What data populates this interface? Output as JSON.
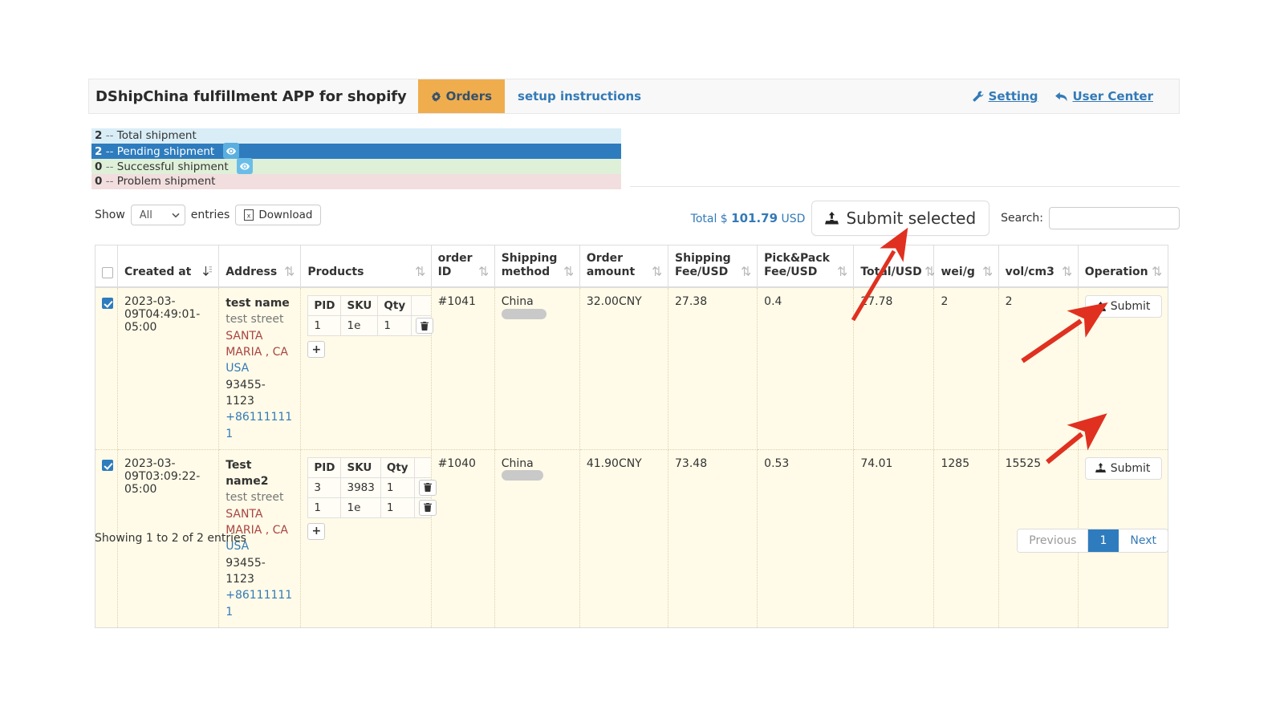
{
  "navbar": {
    "brand": "DShipChina fulfillment APP for shopify",
    "tabs": [
      {
        "label": "Orders",
        "icon": "gear-icon",
        "active": true
      },
      {
        "label": "setup instructions",
        "icon": "",
        "active": false
      }
    ],
    "right_links": [
      {
        "label": "Setting",
        "icon": "wrench-icon"
      },
      {
        "label": "User Center",
        "icon": "reply-icon"
      }
    ]
  },
  "status_bars": [
    {
      "count": "2",
      "dash": "--",
      "label": "Total shipment",
      "has_eye": false,
      "color": "#d9edf7"
    },
    {
      "count": "2",
      "dash": "--",
      "label": "Pending shipment",
      "has_eye": true,
      "color": "#2e7cbe"
    },
    {
      "count": "0",
      "dash": "--",
      "label": "Successful shipment",
      "has_eye": true,
      "color": "#dff0d8"
    },
    {
      "count": "0",
      "dash": "--",
      "label": "Problem shipment",
      "has_eye": false,
      "color": "#f2dede"
    }
  ],
  "controls": {
    "show_label": "Show",
    "entries_label": "entries",
    "length_value": "All",
    "length_options": [
      "All"
    ],
    "download_label": "Download",
    "download_icon": "excel-file-icon",
    "total_prefix": "Total $",
    "total_amount": "101.79",
    "total_suffix": "USD",
    "submit_selected_label": "Submit selected",
    "submit_selected_icon": "upload-icon",
    "search_label": "Search:",
    "search_value": "",
    "search_placeholder": ""
  },
  "table": {
    "columns": [
      {
        "key": "select",
        "label": "",
        "sortable": false,
        "sort": "none"
      },
      {
        "key": "created",
        "label": "Created at",
        "sortable": true,
        "sort": "desc"
      },
      {
        "key": "address",
        "label": "Address",
        "sortable": true,
        "sort": "none"
      },
      {
        "key": "products",
        "label": "Products",
        "sortable": true,
        "sort": "none"
      },
      {
        "key": "orderid",
        "label": "order ID",
        "sortable": true,
        "sort": "none"
      },
      {
        "key": "shipmeth",
        "label": "Shipping method",
        "sortable": true,
        "sort": "none"
      },
      {
        "key": "orderamt",
        "label": "Order amount",
        "sortable": true,
        "sort": "none"
      },
      {
        "key": "shipfee",
        "label": "Shipping Fee/USD",
        "sortable": true,
        "sort": "none"
      },
      {
        "key": "packfee",
        "label": "Pick&Pack Fee/USD",
        "sortable": true,
        "sort": "none"
      },
      {
        "key": "total",
        "label": "Total/USD",
        "sortable": true,
        "sort": "none"
      },
      {
        "key": "wei",
        "label": "wei/g",
        "sortable": true,
        "sort": "none"
      },
      {
        "key": "vol",
        "label": "vol/cm3",
        "sortable": true,
        "sort": "none"
      },
      {
        "key": "operation",
        "label": "Operation",
        "sortable": true,
        "sort": "none"
      }
    ],
    "select_all_checked": false,
    "rows": [
      {
        "checked": true,
        "created_at": "2023-03-09T04:49:01-05:00",
        "address": {
          "name": "test name",
          "street": "test street",
          "city_state": "SANTA MARIA , CA",
          "country": "USA",
          "zip": "93455-1123",
          "phone": "+861111111"
        },
        "products_headers": [
          "PID",
          "SKU",
          "Qty",
          ""
        ],
        "products": [
          {
            "pid": "1",
            "sku": "1e",
            "qty": "1",
            "delete_icon": "trash-icon"
          }
        ],
        "add_product_label": "+",
        "order_id": "#1041",
        "shipping_method": "China",
        "shipping_method_redacted": true,
        "order_amount": "32.00CNY",
        "shipping_fee": "27.38",
        "pick_pack_fee": "0.4",
        "total_usd": "27.78",
        "weight_g": "2",
        "volume_cm3": "2",
        "submit_label": "Submit",
        "submit_icon": "upload-icon"
      },
      {
        "checked": true,
        "created_at": "2023-03-09T03:09:22-05:00",
        "address": {
          "name": "Test name2",
          "street": "test street",
          "city_state": "SANTA MARIA , CA",
          "country": "USA",
          "zip": "93455-1123",
          "phone": "+861111111"
        },
        "products_headers": [
          "PID",
          "SKU",
          "Qty",
          ""
        ],
        "products": [
          {
            "pid": "3",
            "sku": "3983",
            "qty": "1",
            "delete_icon": "trash-icon"
          },
          {
            "pid": "1",
            "sku": "1e",
            "qty": "1",
            "delete_icon": "trash-icon"
          }
        ],
        "add_product_label": "+",
        "order_id": "#1040",
        "shipping_method": "China",
        "shipping_method_redacted": true,
        "order_amount": "41.90CNY",
        "shipping_fee": "73.48",
        "pick_pack_fee": "0.53",
        "total_usd": "74.01",
        "weight_g": "1285",
        "volume_cm3": "15525",
        "submit_label": "Submit",
        "submit_icon": "upload-icon"
      }
    ]
  },
  "footer": {
    "info": "Showing 1 to 2 of 2 entries",
    "pagination": [
      {
        "label": "Previous",
        "state": "disabled"
      },
      {
        "label": "1",
        "state": "active"
      },
      {
        "label": "Next",
        "state": "normal"
      }
    ]
  },
  "annotations": {
    "arrow_color": "#e03020",
    "arrows": 3
  },
  "colors": {
    "accent_orange": "#f0ad4e",
    "link_blue": "#337ab7",
    "active_blue": "#2e7cbe",
    "row_bg": "#fffbe8",
    "arrow_red": "#e03020"
  }
}
